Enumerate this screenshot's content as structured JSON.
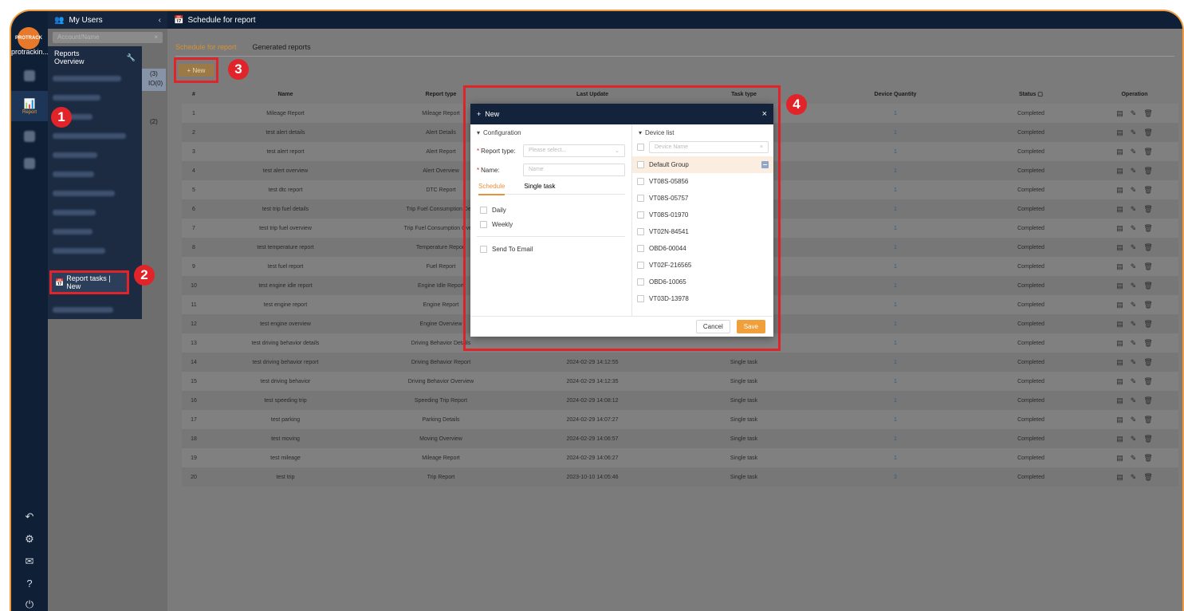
{
  "account": {
    "short_name": "protrackin...",
    "logo_text": "PROTRACK"
  },
  "rail": {
    "report_label": "Report"
  },
  "user_panel": {
    "title": "My Users",
    "search_placeholder": "Account/Name",
    "count_a": "(3)",
    "count_b": "IO(0)",
    "count_c": "(2)"
  },
  "flyout": {
    "title": "Reports Overview",
    "highlight_item": "Report tasks | New"
  },
  "badges": [
    "1",
    "2",
    "3",
    "4"
  ],
  "main": {
    "title": "Schedule for report",
    "tabs": [
      "Schedule for report",
      "Generated reports"
    ],
    "new_button": "+ New",
    "columns": [
      "#",
      "Name",
      "Report type",
      "Last Update",
      "Task type",
      "Device Quantity",
      "Status",
      "Operation"
    ],
    "rows": [
      [
        "1",
        "Mileage Report",
        "Mileage Report",
        "",
        "",
        "1",
        "Completed"
      ],
      [
        "2",
        "test alert details",
        "Alert Details",
        "",
        "",
        "1",
        "Completed"
      ],
      [
        "3",
        "test alert report",
        "Alert Report",
        "",
        "",
        "1",
        "Completed"
      ],
      [
        "4",
        "test alert overview",
        "Alert Overview",
        "",
        "",
        "1",
        "Completed"
      ],
      [
        "5",
        "test dtc report",
        "DTC Report",
        "",
        "",
        "1",
        "Completed"
      ],
      [
        "6",
        "test trip fuel details",
        "Trip Fuel Consumption Deta",
        "",
        "",
        "1",
        "Completed"
      ],
      [
        "7",
        "test trip fuel overview",
        "Trip Fuel Consumption Overvi",
        "",
        "",
        "1",
        "Completed"
      ],
      [
        "8",
        "test temperature report",
        "Temperature Report",
        "",
        "",
        "1",
        "Completed"
      ],
      [
        "9",
        "test fuel report",
        "Fuel Report",
        "",
        "",
        "1",
        "Completed"
      ],
      [
        "10",
        "test engine idle report",
        "Engine Idle Report",
        "",
        "",
        "1",
        "Completed"
      ],
      [
        "11",
        "test engine report",
        "Engine Report",
        "",
        "",
        "1",
        "Completed"
      ],
      [
        "12",
        "test engine overview",
        "Engine Overview",
        "",
        "",
        "1",
        "Completed"
      ],
      [
        "13",
        "test driving behavior details",
        "Driving Behavior Details",
        "",
        "",
        "1",
        "Completed"
      ],
      [
        "14",
        "test driving behavior report",
        "Driving Behavior Report",
        "2024-02-29 14:12:55",
        "Single task",
        "1",
        "Completed"
      ],
      [
        "15",
        "test driving behavior",
        "Driving Behavior Overview",
        "2024-02-29 14:12:35",
        "Single task",
        "1",
        "Completed"
      ],
      [
        "16",
        "test speeding trip",
        "Speeding Trip Report",
        "2024-02-29 14:08:12",
        "Single task",
        "1",
        "Completed"
      ],
      [
        "17",
        "test parking",
        "Parking Details",
        "2024-02-29 14:07:27",
        "Single task",
        "1",
        "Completed"
      ],
      [
        "18",
        "test moving",
        "Moving Overview",
        "2024-02-29 14:06:57",
        "Single task",
        "1",
        "Completed"
      ],
      [
        "19",
        "test mileage",
        "Mileage Report",
        "2024-02-29 14:06:27",
        "Single task",
        "1",
        "Completed"
      ],
      [
        "20",
        "test trip",
        "Trip Report",
        "2023-10-10 14:05:46",
        "Single task",
        "3",
        "Completed"
      ]
    ]
  },
  "modal": {
    "title": "New",
    "config_title": "Configuration",
    "report_type_label": "Report type:",
    "report_type_placeholder": "Please select...",
    "name_label": "Name:",
    "name_placeholder": "Name",
    "tabs": [
      "Schedule",
      "Single task"
    ],
    "daily": "Daily",
    "weekly": "Weekly",
    "send_email": "Send To Email",
    "device_list_title": "Device list",
    "device_search_placeholder": "Device Name",
    "group": "Default Group",
    "devices": [
      "VT08S-05856",
      "VT08S-05757",
      "VT08S-01970",
      "VT02N-84541",
      "OBD6-00044",
      "VT02F-216565",
      "OBD6-10065",
      "VT03D-13978"
    ],
    "cancel": "Cancel",
    "save": "Save"
  },
  "colors": {
    "highlight": "#e0242a",
    "accent": "#f0a03a",
    "navy": "#0f1f36"
  }
}
